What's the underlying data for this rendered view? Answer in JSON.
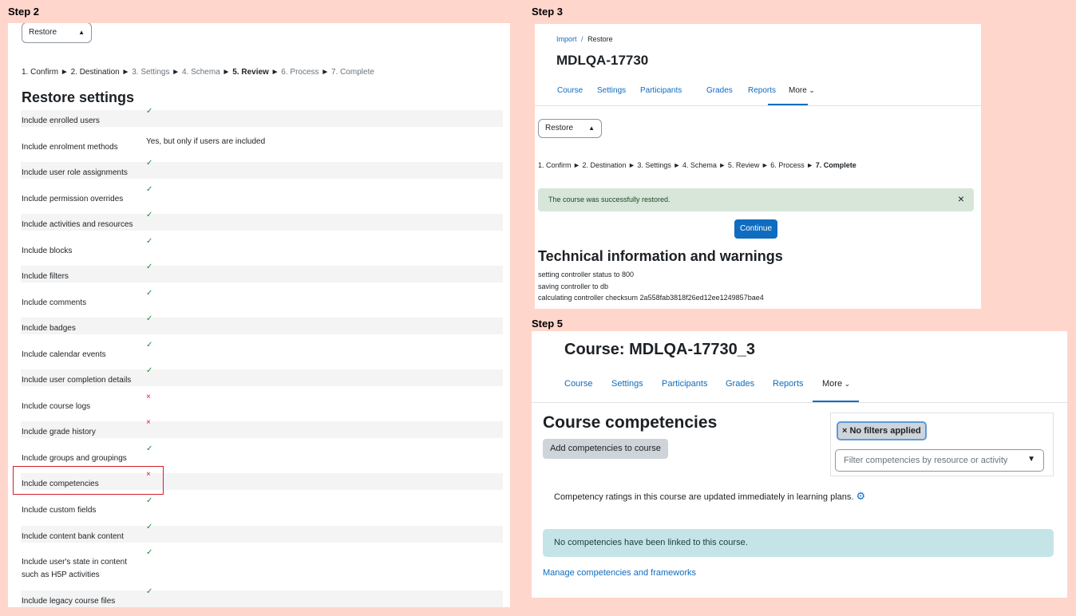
{
  "steps": {
    "step2": "Step 2",
    "step3": "Step 3",
    "step5": "Step 5"
  },
  "step2": {
    "select_value": "Restore",
    "crumbs": [
      {
        "text": "1. Confirm",
        "style": "normal"
      },
      {
        "text": " ► ",
        "style": "normal"
      },
      {
        "text": "2. Destination",
        "style": "normal"
      },
      {
        "text": " ► ",
        "style": "normal"
      },
      {
        "text": "3. Settings",
        "style": "dim"
      },
      {
        "text": " ► ",
        "style": "normal"
      },
      {
        "text": "4. Schema",
        "style": "dim"
      },
      {
        "text": " ► ",
        "style": "normal"
      },
      {
        "text": "5. Review",
        "style": "bold"
      },
      {
        "text": " ► ",
        "style": "normal"
      },
      {
        "text": "6. Process",
        "style": "dim"
      },
      {
        "text": " ► ",
        "style": "normal"
      },
      {
        "text": "7. Complete",
        "style": "dim"
      }
    ],
    "heading": "Restore settings",
    "settings": [
      {
        "label": "Include enrolled users",
        "value": "check"
      },
      {
        "label": "Include enrolment methods",
        "value": "Yes, but only if users are included"
      },
      {
        "label": "Include user role assignments",
        "value": "check"
      },
      {
        "label": "Include permission overrides",
        "value": "check"
      },
      {
        "label": "Include activities and resources",
        "value": "check"
      },
      {
        "label": "Include blocks",
        "value": "check"
      },
      {
        "label": "Include filters",
        "value": "check"
      },
      {
        "label": "Include comments",
        "value": "check"
      },
      {
        "label": "Include badges",
        "value": "check"
      },
      {
        "label": "Include calendar events",
        "value": "check"
      },
      {
        "label": "Include user completion details",
        "value": "check"
      },
      {
        "label": "Include course logs",
        "value": "cross"
      },
      {
        "label": "Include grade history",
        "value": "cross"
      },
      {
        "label": "Include groups and groupings",
        "value": "check"
      },
      {
        "label": "Include competencies",
        "value": "cross"
      },
      {
        "label": "Include custom fields",
        "value": "check"
      },
      {
        "label": "Include content bank content",
        "value": "check"
      },
      {
        "label": "Include user's state in content such as H5P activities",
        "value": "check"
      },
      {
        "label": "Include legacy course files",
        "value": "check"
      }
    ],
    "check_glyph": "✓",
    "cross_glyph": "×"
  },
  "step3": {
    "breadcrumb_import": "Import",
    "breadcrumb_sep": "/",
    "breadcrumb_restore": "Restore",
    "course_title": "MDLQA-17730",
    "tabs": [
      "Course",
      "Settings",
      "Participants",
      "Grades",
      "Reports"
    ],
    "more_tab": "More",
    "select_value": "Restore",
    "crumbs": [
      {
        "text": "1. Confirm",
        "style": "normal"
      },
      {
        "text": " ► ",
        "style": "normal"
      },
      {
        "text": "2. Destination",
        "style": "normal"
      },
      {
        "text": " ► ",
        "style": "normal"
      },
      {
        "text": "3. Settings",
        "style": "normal"
      },
      {
        "text": " ► ",
        "style": "normal"
      },
      {
        "text": "4. Schema",
        "style": "normal"
      },
      {
        "text": " ► ",
        "style": "normal"
      },
      {
        "text": "5. Review",
        "style": "normal"
      },
      {
        "text": " ► ",
        "style": "normal"
      },
      {
        "text": "6. Process",
        "style": "normal"
      },
      {
        "text": " ► ",
        "style": "normal"
      },
      {
        "text": "7. Complete",
        "style": "bold"
      }
    ],
    "success_message": "The course was successfully restored.",
    "close_glyph": "×",
    "continue_label": "Continue",
    "tech_heading": "Technical information and warnings",
    "tech_lines": [
      "setting controller status to 800",
      "saving controller to db",
      "calculating controller checksum 2a558fab3818f26ed12ee1249857bae4"
    ]
  },
  "step5": {
    "course_title": "Course: MDLQA-17730_3",
    "tabs": [
      "Course",
      "Settings",
      "Participants",
      "Grades",
      "Reports"
    ],
    "more_tab": "More",
    "heading": "Course competencies",
    "add_button": "Add competencies to course",
    "filter_badge": "× No filters applied",
    "filter_placeholder": "Filter competencies by resource or activity",
    "ratings_text": "Competency ratings in this course are updated immediately in learning plans.",
    "no_competencies": "No competencies have been linked to this course.",
    "manage_link": "Manage competencies and frameworks"
  },
  "colors": {
    "accent": "#0f6cbf",
    "success_bg": "#d7e6d9",
    "info_bg": "#c5e4e8",
    "check": "#1b8a36",
    "cross": "#d0202a"
  }
}
